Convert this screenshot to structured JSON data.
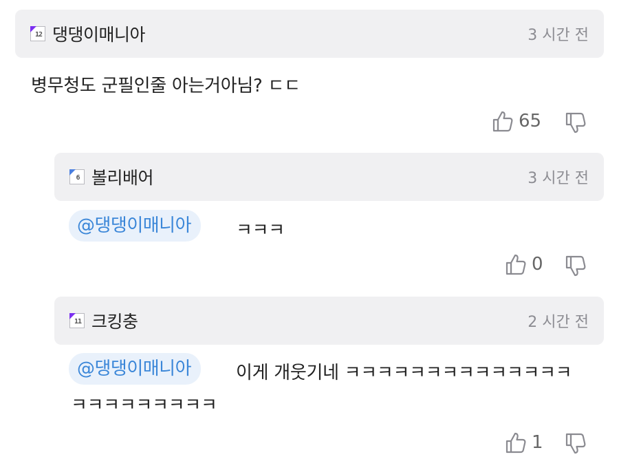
{
  "comments": [
    {
      "nickname": "댕댕이매니아",
      "level": "12",
      "time": "3 시간 전",
      "text": "병무청도 군필인줄 아는거아님? ㄷㄷ",
      "likes": "65"
    },
    {
      "nickname": "볼리배어",
      "level": "6",
      "time": "3 시간 전",
      "mention": "@댕댕이매니아",
      "text": "ㅋㅋㅋ",
      "likes": "0"
    },
    {
      "nickname": "크킹충",
      "level": "11",
      "time": "2 시간 전",
      "mention": "@댕댕이매니아",
      "text_line1": "이게 개웃기네 ㅋㅋㅋㅋㅋㅋㅋㅋㅋㅋㅋㅋㅋㅋ",
      "text_line2": "ㅋㅋㅋㅋㅋㅋㅋㅋㅋ",
      "likes": "1"
    }
  ],
  "icons": {
    "like": "thumbs-up-icon",
    "dislike": "thumbs-down-icon"
  },
  "colors": {
    "header_bg": "#f0f0f2",
    "mention_bg": "#e9f1fb",
    "mention_text": "#3a86d8",
    "level_purple": "#7b2ff0",
    "level_blue": "#4a7fe0"
  }
}
